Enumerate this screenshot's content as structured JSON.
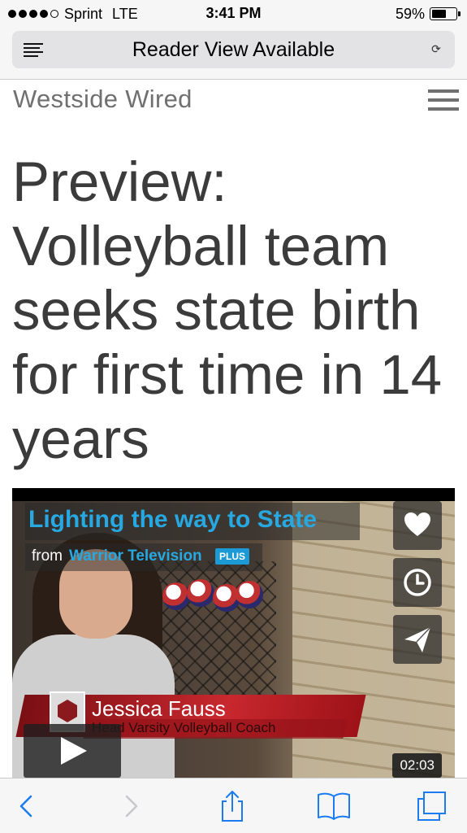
{
  "status_bar": {
    "carrier": "Sprint",
    "network": "LTE",
    "time": "3:41 PM",
    "battery": "59%",
    "battery_level": 0.59,
    "signal_bars_filled": 4,
    "signal_bars_total": 5
  },
  "reader_bar": {
    "label": "Reader View Available",
    "reader_icon": "reader-lines-icon",
    "reload_icon": "reload-icon"
  },
  "site": {
    "name": "Westside Wired",
    "menu_icon": "hamburger-menu-icon"
  },
  "article": {
    "headline": "Preview: Volleyball team seeks state birth for first time in 14 years"
  },
  "video": {
    "title": "Lighting the way to State",
    "from_prefix": "from",
    "channel": "Warrior Television",
    "badge": "PLUS",
    "person_name": "Jessica Fauss",
    "person_role": "Head Varsity Volleyball Coach",
    "duration": "02:03",
    "actions": [
      "heart-icon",
      "clock-icon",
      "send-icon"
    ],
    "accent_color": "#27a8e0"
  },
  "toolbar": {
    "buttons": [
      "back-icon",
      "forward-icon",
      "share-icon",
      "bookmarks-icon",
      "tabs-icon"
    ],
    "tint_color": "#1a7cf0"
  }
}
